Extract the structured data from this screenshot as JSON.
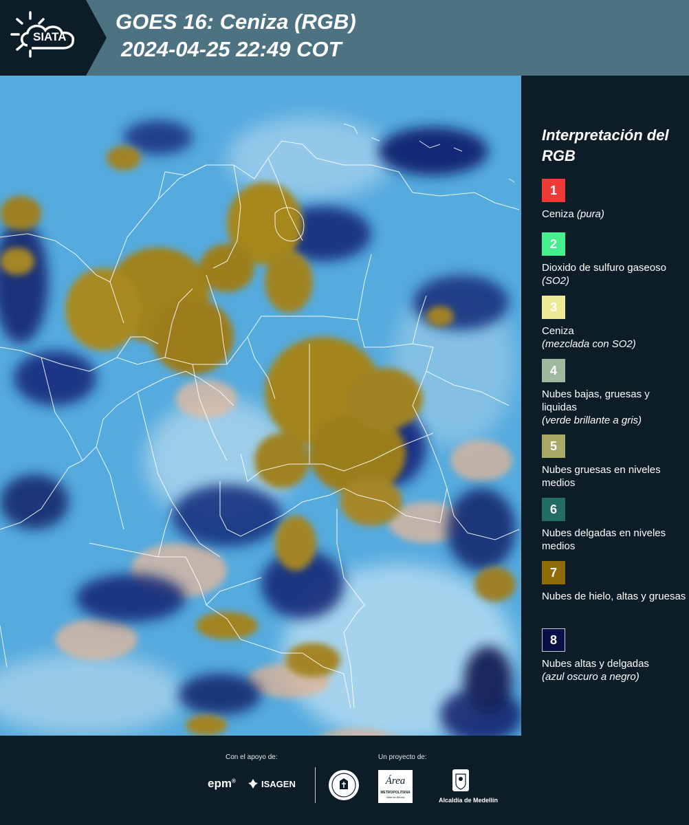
{
  "header": {
    "logo_text": "SIATA",
    "title_line1": "GOES 16: Ceniza (RGB)",
    "title_line2": "2024-04-25 22:49 COT"
  },
  "legend": {
    "title": "Interpretación del RGB",
    "items": [
      {
        "num": "1",
        "color": "#ef3a3a",
        "label": "Ceniza",
        "note": "(pura)"
      },
      {
        "num": "2",
        "color": "#44ef8e",
        "label": "Dioxido de sulfuro gaseoso",
        "note": "(SO2)"
      },
      {
        "num": "3",
        "color": "#ecea94",
        "label": "Ceniza",
        "note": "(mezclada con SO2)"
      },
      {
        "num": "4",
        "color": "#9fb9a1",
        "label": "Nubes bajas, gruesas y liquidas",
        "note": "(verde brillante a gris)"
      },
      {
        "num": "5",
        "color": "#a9aa6a",
        "label": "Nubes gruesas en niveles medios",
        "note": ""
      },
      {
        "num": "6",
        "color": "#236c64",
        "label": "Nubes delgadas en niveles medios",
        "note": ""
      },
      {
        "num": "7",
        "color": "#8f6c0a",
        "label": "Nubes de hielo, altas y gruesas",
        "note": ""
      },
      {
        "num": "8",
        "color": "#091047",
        "label": "Nubes altas y delgadas",
        "note": "(azul oscuro a negro)"
      }
    ]
  },
  "footer": {
    "support_caption": "Con el apoyo de:",
    "project_caption": "Un proyecto de:",
    "logo_epm": "epm",
    "logo_isagen": "ISAGEN",
    "logo_area": "Área",
    "logo_area_sub": "METROPOLITANA",
    "logo_area_sub2": "Valle de Aburrá",
    "logo_alcaldia": "Alcaldía de Medellín"
  }
}
